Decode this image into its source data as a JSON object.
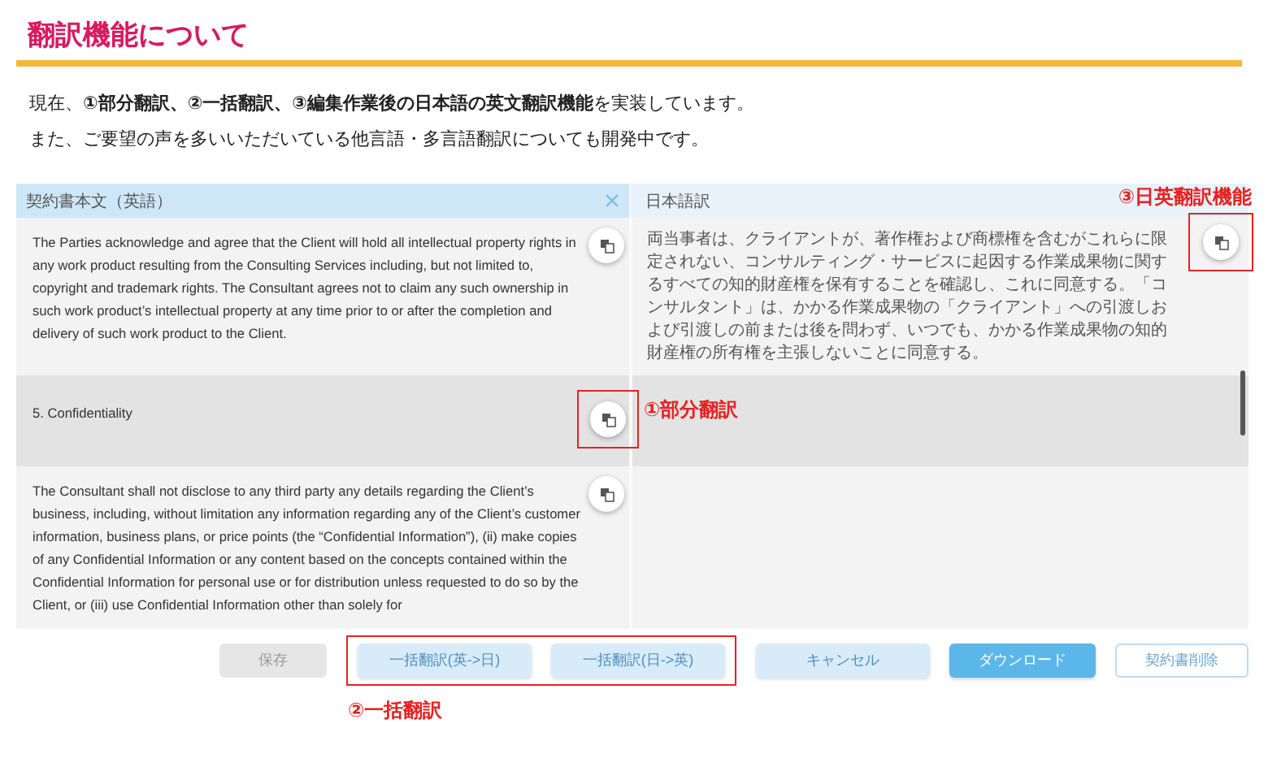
{
  "heading": "翻訳機能について",
  "paragraphs": [
    "現在、**①部分翻訳、②一括翻訳、③編集作業後の日本語の英文翻訳機能**を実装しています。",
    "また、ご要望の声を多いいただいている他言語・多言語翻訳についても開発中です。"
  ],
  "editor": {
    "source_header": "契約書本文（英語）",
    "target_header": "日本語訳",
    "segments": [
      {
        "english": "The Parties acknowledge and agree that the Client will hold all intellectual property rights in any work product resulting from the Consulting Services including, but not limited to, copyright and trademark rights. The Consultant agrees not to claim any such ownership in such work product’s intellectual property at any time prior to or after the completion and delivery of such work product to the Client.",
        "japanese": "両当事者は、クライアントが、著作権および商標権を含むがこれらに限定されない、コンサルティング・サービスに起因する作業成果物に関するすべての知的財産権を保有することを確認し、これに同意する。「コンサルタント」は、かかる作業成果物の「クライアント」への引渡しおよび引渡しの前または後を問わず、いつでも、かかる作業成果物の知的財産権の所有権を主張しないことに同意する。",
        "highlighted": false,
        "ja_button": true,
        "ja_callout": "③日英翻訳機能"
      },
      {
        "english": "5. Confidentiality",
        "highlighted": true,
        "ja_button": false,
        "en_callout": "①部分翻訳"
      },
      {
        "english": "The Consultant shall not disclose to any third party any details regarding the Client’s business, including, without limitation any information regarding any of the Client’s customer information, business plans, or price points (the “Confidential Information”), (ii) make copies of any Confidential Information or any content based on the concepts contained within the Confidential Information for personal use or for distribution unless requested to do so by the Client, or (iii) use Confidential Information other than solely for",
        "highlighted": false,
        "ja_button": false
      }
    ],
    "buttons": [
      {
        "label": "保存",
        "kind": "disabled",
        "in_callout": false
      },
      {
        "label": "一括翻訳(英->日)",
        "kind": "light",
        "in_callout": true
      },
      {
        "label": "一括翻訳(日->英)",
        "kind": "light",
        "in_callout": true
      },
      {
        "label": "キャンセル",
        "kind": "light",
        "in_callout": false
      },
      {
        "label": "ダウンロード",
        "kind": "primary",
        "in_callout": false
      },
      {
        "label": "契約書削除",
        "kind": "outline",
        "in_callout": false
      }
    ],
    "buttons_callout": "②一括翻訳"
  }
}
